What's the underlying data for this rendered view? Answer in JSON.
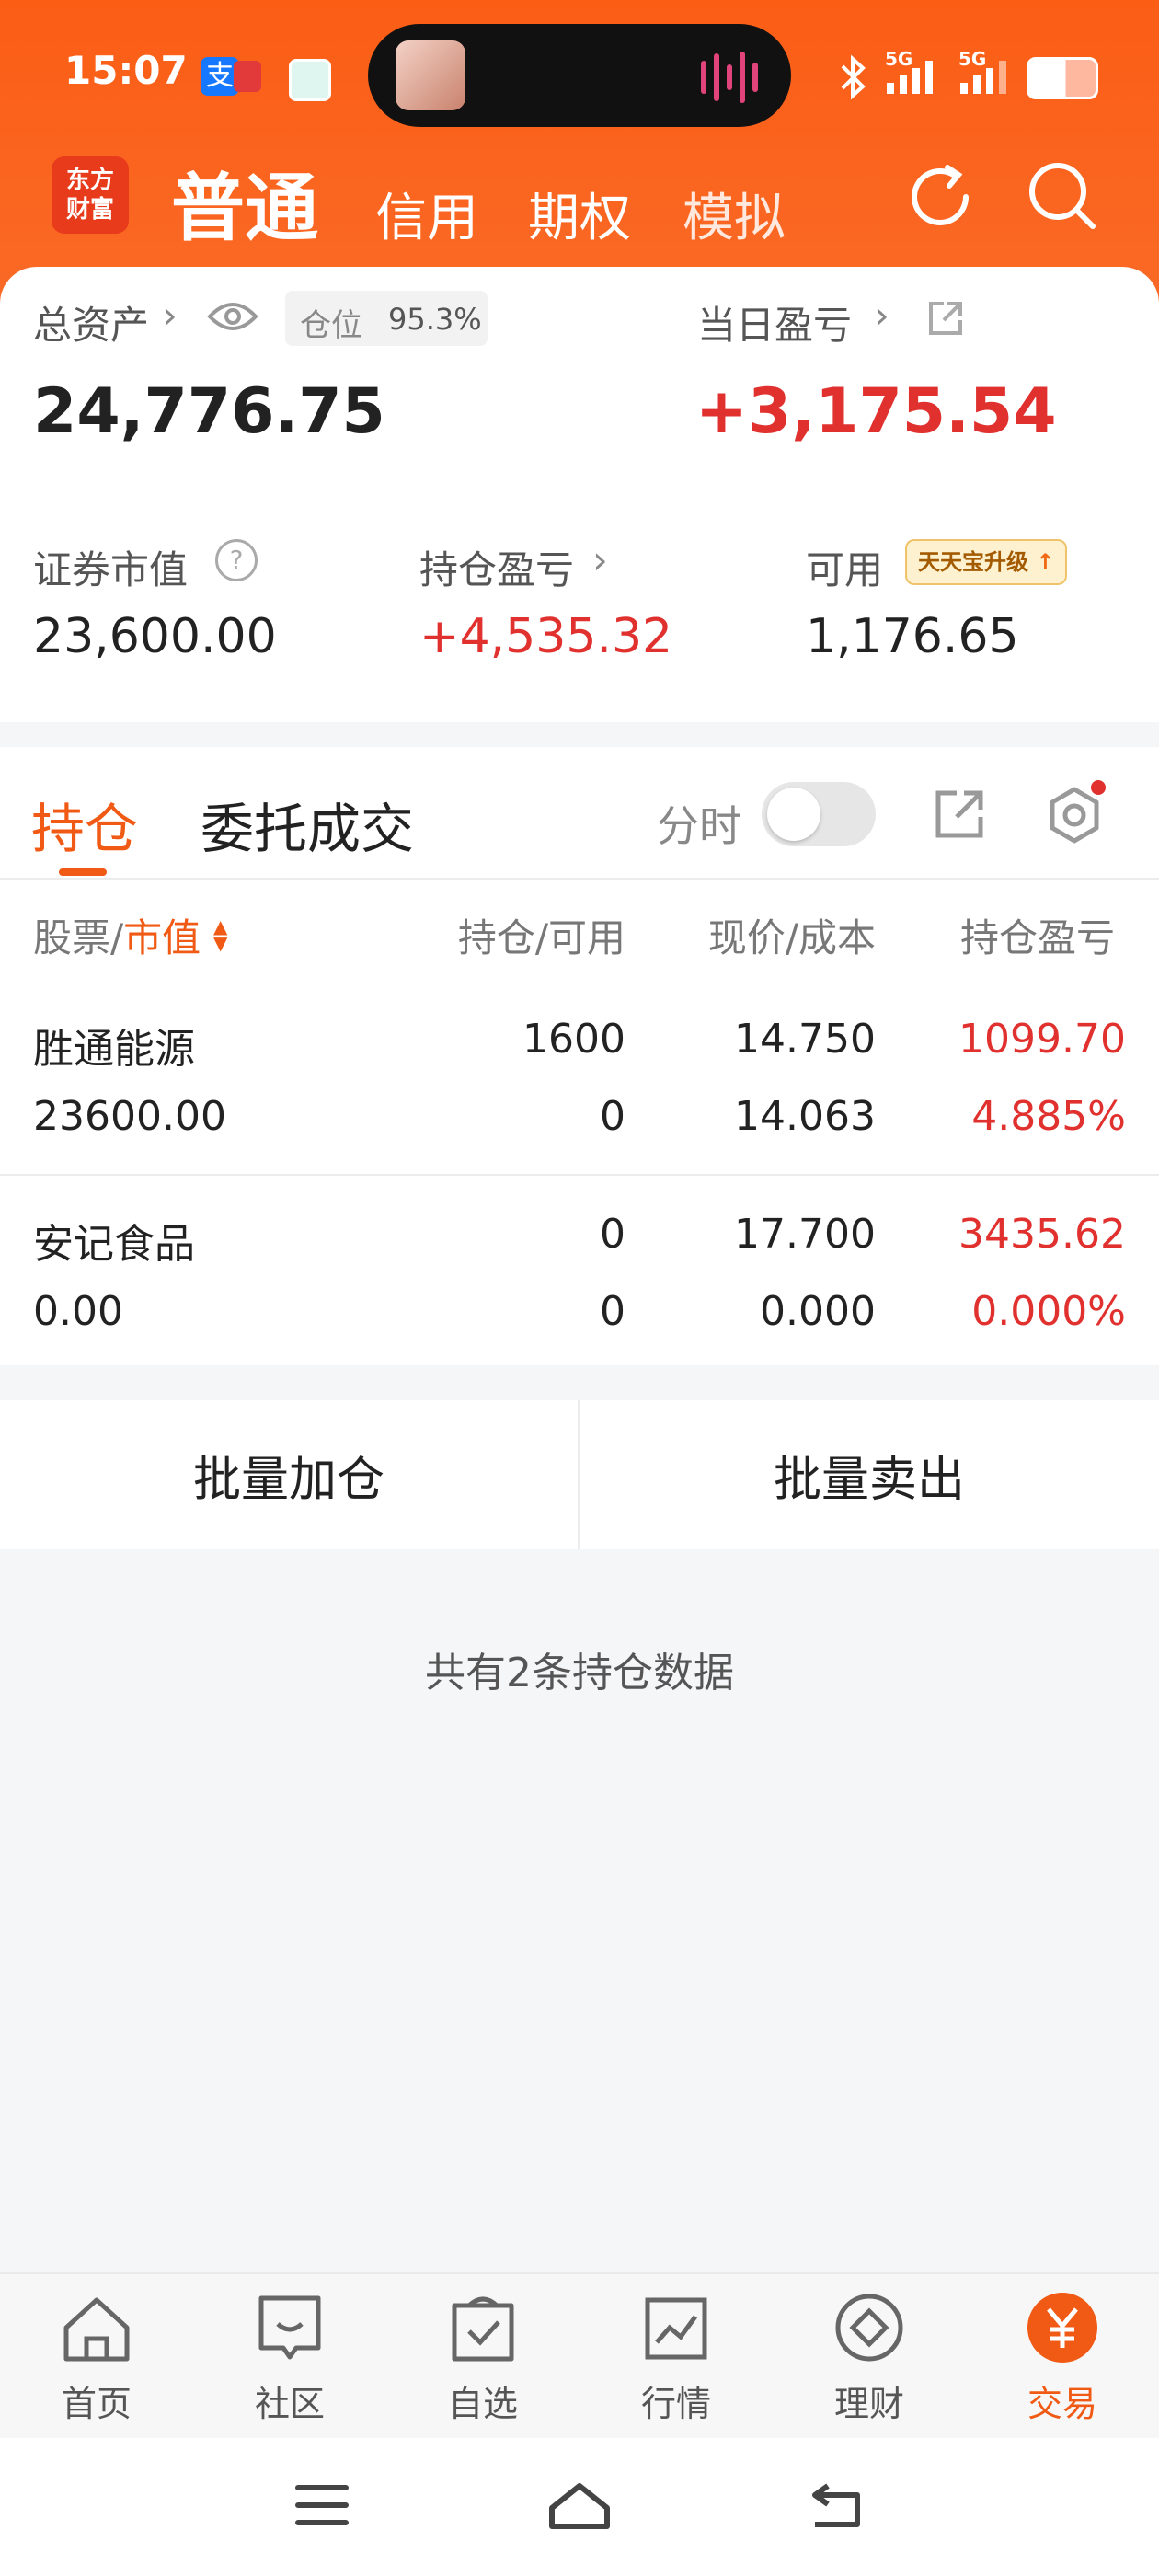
{
  "status_bar": {
    "time": "15:07",
    "network1": "5G",
    "network2": "5G"
  },
  "header": {
    "logo_line1": "东方",
    "logo_line2": "财富",
    "tabs": [
      "普通",
      "信用",
      "期权",
      "模拟"
    ],
    "active_tab": "普通"
  },
  "summary": {
    "total_assets_label": "总资产",
    "position_label": "仓位",
    "position_value": "95.3%",
    "total_assets": "24,776.75",
    "daily_pnl_label": "当日盈亏",
    "daily_pnl": "+3,175.54",
    "market_value_label": "证券市值",
    "market_value": "23,600.00",
    "holding_pnl_label": "持仓盈亏",
    "holding_pnl": "+4,535.32",
    "available_label": "可用",
    "available_badge": "天天宝升级",
    "available": "1,176.65"
  },
  "subtabs": {
    "holdings": "持仓",
    "orders": "委托成交",
    "time_share": "分时"
  },
  "table": {
    "headers": {
      "stock": "股票/",
      "stock_sort": "市值",
      "qty": "持仓/可用",
      "price": "现价/成本",
      "pnl": "持仓盈亏"
    },
    "rows": [
      {
        "name": "胜通能源",
        "market_value": "23600.00",
        "holding": "1600",
        "available": "0",
        "price": "14.750",
        "cost": "14.063",
        "pnl": "1099.70",
        "pnl_pct": "4.885%"
      },
      {
        "name": "安记食品",
        "market_value": "0.00",
        "holding": "0",
        "available": "0",
        "price": "17.700",
        "cost": "0.000",
        "pnl": "3435.62",
        "pnl_pct": "0.000%"
      }
    ]
  },
  "actions": {
    "add": "批量加仓",
    "sell": "批量卖出"
  },
  "footer_note": "共有2条持仓数据",
  "bottom_nav": [
    {
      "label": "首页",
      "icon": "home-icon"
    },
    {
      "label": "社区",
      "icon": "chat-icon"
    },
    {
      "label": "自选",
      "icon": "bag-check-icon"
    },
    {
      "label": "行情",
      "icon": "chart-icon"
    },
    {
      "label": "理财",
      "icon": "diamond-icon"
    },
    {
      "label": "交易",
      "icon": "yen-icon"
    }
  ],
  "colors": {
    "brand": "#fa5f1a",
    "up_red": "#e0312f",
    "accent_orange": "#f05a14"
  }
}
